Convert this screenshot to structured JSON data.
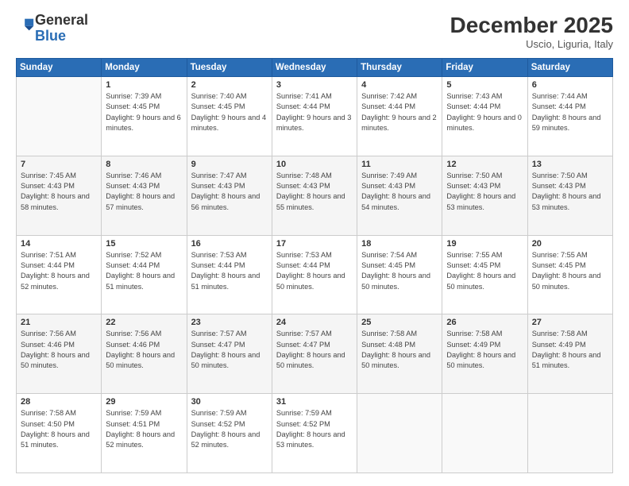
{
  "header": {
    "logo_line1": "General",
    "logo_line2": "Blue",
    "month_year": "December 2025",
    "location": "Uscio, Liguria, Italy"
  },
  "weekdays": [
    "Sunday",
    "Monday",
    "Tuesday",
    "Wednesday",
    "Thursday",
    "Friday",
    "Saturday"
  ],
  "weeks": [
    [
      {
        "day": "",
        "sunrise": "",
        "sunset": "",
        "daylight": ""
      },
      {
        "day": "1",
        "sunrise": "Sunrise: 7:39 AM",
        "sunset": "Sunset: 4:45 PM",
        "daylight": "Daylight: 9 hours and 6 minutes."
      },
      {
        "day": "2",
        "sunrise": "Sunrise: 7:40 AM",
        "sunset": "Sunset: 4:45 PM",
        "daylight": "Daylight: 9 hours and 4 minutes."
      },
      {
        "day": "3",
        "sunrise": "Sunrise: 7:41 AM",
        "sunset": "Sunset: 4:44 PM",
        "daylight": "Daylight: 9 hours and 3 minutes."
      },
      {
        "day": "4",
        "sunrise": "Sunrise: 7:42 AM",
        "sunset": "Sunset: 4:44 PM",
        "daylight": "Daylight: 9 hours and 2 minutes."
      },
      {
        "day": "5",
        "sunrise": "Sunrise: 7:43 AM",
        "sunset": "Sunset: 4:44 PM",
        "daylight": "Daylight: 9 hours and 0 minutes."
      },
      {
        "day": "6",
        "sunrise": "Sunrise: 7:44 AM",
        "sunset": "Sunset: 4:44 PM",
        "daylight": "Daylight: 8 hours and 59 minutes."
      }
    ],
    [
      {
        "day": "7",
        "sunrise": "Sunrise: 7:45 AM",
        "sunset": "Sunset: 4:43 PM",
        "daylight": "Daylight: 8 hours and 58 minutes."
      },
      {
        "day": "8",
        "sunrise": "Sunrise: 7:46 AM",
        "sunset": "Sunset: 4:43 PM",
        "daylight": "Daylight: 8 hours and 57 minutes."
      },
      {
        "day": "9",
        "sunrise": "Sunrise: 7:47 AM",
        "sunset": "Sunset: 4:43 PM",
        "daylight": "Daylight: 8 hours and 56 minutes."
      },
      {
        "day": "10",
        "sunrise": "Sunrise: 7:48 AM",
        "sunset": "Sunset: 4:43 PM",
        "daylight": "Daylight: 8 hours and 55 minutes."
      },
      {
        "day": "11",
        "sunrise": "Sunrise: 7:49 AM",
        "sunset": "Sunset: 4:43 PM",
        "daylight": "Daylight: 8 hours and 54 minutes."
      },
      {
        "day": "12",
        "sunrise": "Sunrise: 7:50 AM",
        "sunset": "Sunset: 4:43 PM",
        "daylight": "Daylight: 8 hours and 53 minutes."
      },
      {
        "day": "13",
        "sunrise": "Sunrise: 7:50 AM",
        "sunset": "Sunset: 4:43 PM",
        "daylight": "Daylight: 8 hours and 53 minutes."
      }
    ],
    [
      {
        "day": "14",
        "sunrise": "Sunrise: 7:51 AM",
        "sunset": "Sunset: 4:44 PM",
        "daylight": "Daylight: 8 hours and 52 minutes."
      },
      {
        "day": "15",
        "sunrise": "Sunrise: 7:52 AM",
        "sunset": "Sunset: 4:44 PM",
        "daylight": "Daylight: 8 hours and 51 minutes."
      },
      {
        "day": "16",
        "sunrise": "Sunrise: 7:53 AM",
        "sunset": "Sunset: 4:44 PM",
        "daylight": "Daylight: 8 hours and 51 minutes."
      },
      {
        "day": "17",
        "sunrise": "Sunrise: 7:53 AM",
        "sunset": "Sunset: 4:44 PM",
        "daylight": "Daylight: 8 hours and 50 minutes."
      },
      {
        "day": "18",
        "sunrise": "Sunrise: 7:54 AM",
        "sunset": "Sunset: 4:45 PM",
        "daylight": "Daylight: 8 hours and 50 minutes."
      },
      {
        "day": "19",
        "sunrise": "Sunrise: 7:55 AM",
        "sunset": "Sunset: 4:45 PM",
        "daylight": "Daylight: 8 hours and 50 minutes."
      },
      {
        "day": "20",
        "sunrise": "Sunrise: 7:55 AM",
        "sunset": "Sunset: 4:45 PM",
        "daylight": "Daylight: 8 hours and 50 minutes."
      }
    ],
    [
      {
        "day": "21",
        "sunrise": "Sunrise: 7:56 AM",
        "sunset": "Sunset: 4:46 PM",
        "daylight": "Daylight: 8 hours and 50 minutes."
      },
      {
        "day": "22",
        "sunrise": "Sunrise: 7:56 AM",
        "sunset": "Sunset: 4:46 PM",
        "daylight": "Daylight: 8 hours and 50 minutes."
      },
      {
        "day": "23",
        "sunrise": "Sunrise: 7:57 AM",
        "sunset": "Sunset: 4:47 PM",
        "daylight": "Daylight: 8 hours and 50 minutes."
      },
      {
        "day": "24",
        "sunrise": "Sunrise: 7:57 AM",
        "sunset": "Sunset: 4:47 PM",
        "daylight": "Daylight: 8 hours and 50 minutes."
      },
      {
        "day": "25",
        "sunrise": "Sunrise: 7:58 AM",
        "sunset": "Sunset: 4:48 PM",
        "daylight": "Daylight: 8 hours and 50 minutes."
      },
      {
        "day": "26",
        "sunrise": "Sunrise: 7:58 AM",
        "sunset": "Sunset: 4:49 PM",
        "daylight": "Daylight: 8 hours and 50 minutes."
      },
      {
        "day": "27",
        "sunrise": "Sunrise: 7:58 AM",
        "sunset": "Sunset: 4:49 PM",
        "daylight": "Daylight: 8 hours and 51 minutes."
      }
    ],
    [
      {
        "day": "28",
        "sunrise": "Sunrise: 7:58 AM",
        "sunset": "Sunset: 4:50 PM",
        "daylight": "Daylight: 8 hours and 51 minutes."
      },
      {
        "day": "29",
        "sunrise": "Sunrise: 7:59 AM",
        "sunset": "Sunset: 4:51 PM",
        "daylight": "Daylight: 8 hours and 52 minutes."
      },
      {
        "day": "30",
        "sunrise": "Sunrise: 7:59 AM",
        "sunset": "Sunset: 4:52 PM",
        "daylight": "Daylight: 8 hours and 52 minutes."
      },
      {
        "day": "31",
        "sunrise": "Sunrise: 7:59 AM",
        "sunset": "Sunset: 4:52 PM",
        "daylight": "Daylight: 8 hours and 53 minutes."
      },
      {
        "day": "",
        "sunrise": "",
        "sunset": "",
        "daylight": ""
      },
      {
        "day": "",
        "sunrise": "",
        "sunset": "",
        "daylight": ""
      },
      {
        "day": "",
        "sunrise": "",
        "sunset": "",
        "daylight": ""
      }
    ]
  ]
}
